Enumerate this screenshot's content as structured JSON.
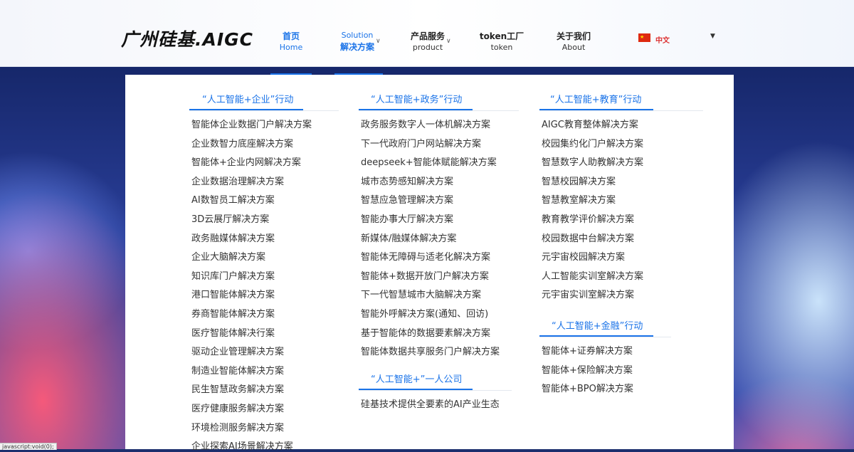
{
  "header": {
    "logo": "广州硅基.AIGC",
    "nav": [
      {
        "zh": "首页",
        "en": "Home"
      },
      {
        "zh": "解决方案",
        "en": "Solution"
      },
      {
        "zh": "产品服务",
        "en": "product"
      },
      {
        "zh": "token工厂",
        "en": "token"
      },
      {
        "zh": "关于我们",
        "en": "About"
      }
    ],
    "language": "中文"
  },
  "menu": {
    "enterprise": {
      "title": "“人工智能+企业”行动",
      "items": [
        "智能体企业数据门户解决方案",
        "企业数智力底座解决方案",
        "智能体+企业内网解决方案",
        "企业数据治理解决方案",
        "AI数智员工解决方案",
        "3D云展厅解决方案",
        "政务融媒体解决方案",
        "企业大脑解决方案",
        "知识库门户解决方案",
        "港口智能体解决方案",
        "券商智能体解决方案",
        "医疗智能体解决行案",
        "驱动企业管理解决方案",
        "制造业智能体解决方案",
        "民生智慧政务解决方案",
        "医疗健康服务解决方案",
        "环境检测服务解决方案",
        "企业探索AI场景解决方案"
      ]
    },
    "government": {
      "title": "“人工智能+政务”行动",
      "items": [
        "政务服务数字人一体机解决方案",
        "下一代政府门户网站解决方案",
        "deepseek+智能体赋能解决方案",
        "城市态势感知解决方案",
        "智慧应急管理解决方案",
        "智能办事大厅解决方案",
        "新媒体/融媒体解决方案",
        "智能体无障碍与适老化解决方案",
        "智能体+数据开放门户解决方案",
        "下一代智慧城市大脑解决方案",
        "智能外呼解决方案(通知、回访)",
        "基于智能体的数据要素解决方案",
        "智能体数据共享服务门户解决方案"
      ]
    },
    "company": {
      "title": "“人工智能+”一人公司",
      "items": [
        "硅基技术提供全要素的AI产业生态"
      ]
    },
    "education": {
      "title": "“人工智能+教育”行动",
      "items": [
        "AIGC教育整体解决方案",
        "校园集约化门户解决方案",
        "智慧数字人助教解决方案",
        "智慧校园解决方案",
        "智慧教室解决方案",
        "教育教学评价解决方案",
        "校园数据中台解决方案",
        "元宇宙校园解决方案",
        "人工智能实训室解决方案",
        "元宇宙实训室解决方案"
      ]
    },
    "finance": {
      "title": "“人工智能+金融”行动",
      "items": [
        "智能体+证券解决方案",
        "智能体+保险解决方案",
        "智能体+BPO解决方案"
      ]
    }
  },
  "status_bar": "javascript:void(0);",
  "colors": {
    "accent": "#1a73e8",
    "text": "#333333"
  }
}
